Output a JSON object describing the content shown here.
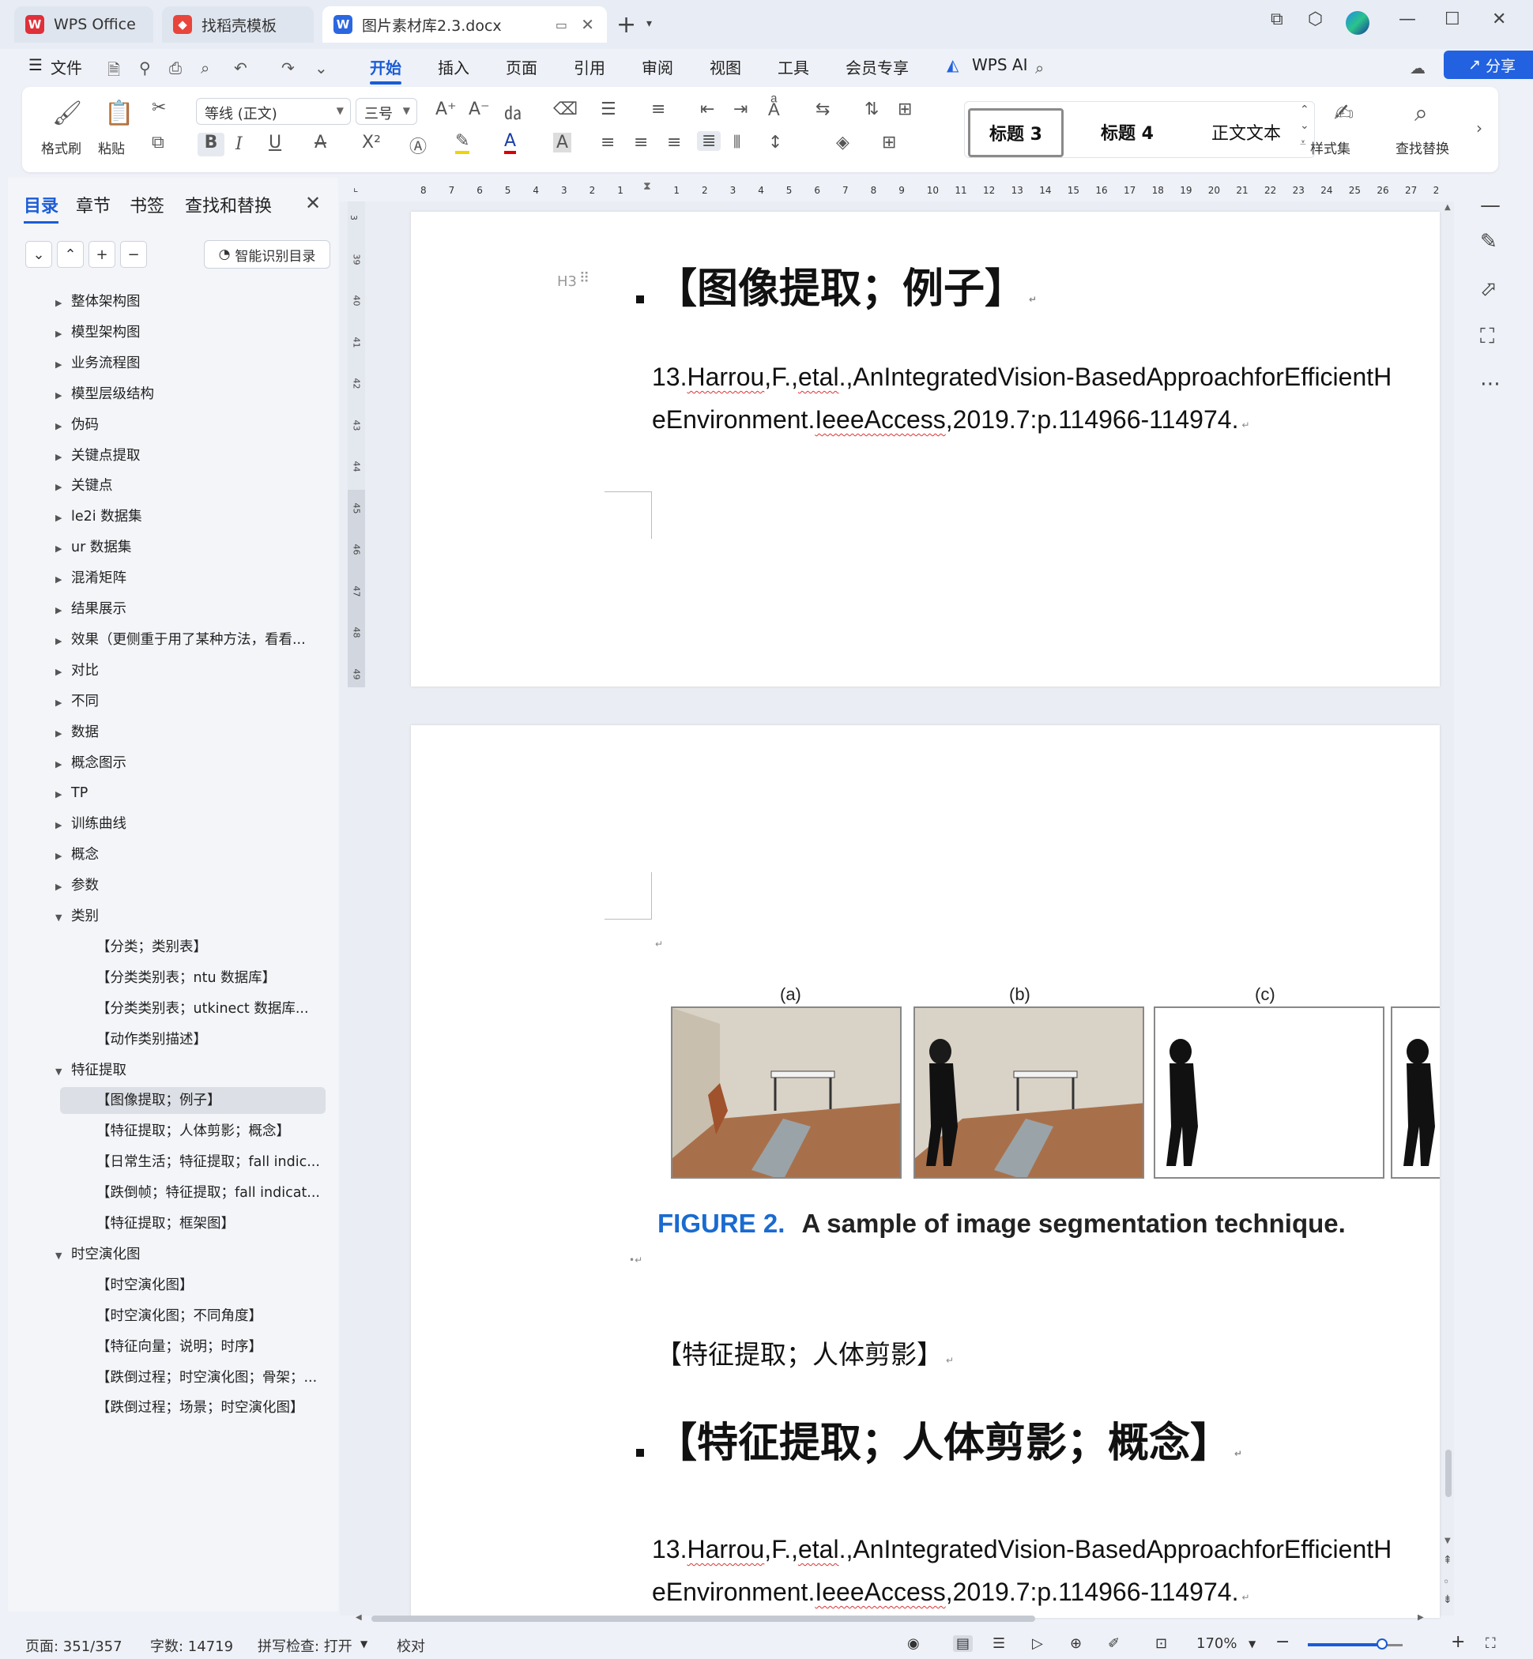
{
  "tabs": {
    "wps": "WPS Office",
    "template": "找稻壳模板",
    "doc": "图片素材库2.3.docx"
  },
  "menu": {
    "file": "文件",
    "items": [
      "开始",
      "插入",
      "页面",
      "引用",
      "审阅",
      "视图",
      "工具",
      "会员专享"
    ],
    "wps_ai": "WPS AI",
    "share": "分享"
  },
  "ribbon": {
    "format_painter": "格式刷",
    "paste": "粘贴",
    "font_name": "等线 (正文)",
    "font_size": "三号",
    "styles": [
      "标题 3",
      "标题 4",
      "正文文本"
    ],
    "style_set": "样式集",
    "find_replace": "查找替换"
  },
  "sidebar": {
    "tabs": [
      "目录",
      "章节",
      "书签",
      "查找和替换"
    ],
    "smart_toc": "智能识别目录",
    "items": [
      {
        "label": "整体架构图",
        "level": 1,
        "state": "collapsed"
      },
      {
        "label": "模型架构图",
        "level": 1,
        "state": "collapsed"
      },
      {
        "label": "业务流程图",
        "level": 1,
        "state": "collapsed"
      },
      {
        "label": "模型层级结构",
        "level": 1,
        "state": "collapsed"
      },
      {
        "label": "伪码",
        "level": 1,
        "state": "collapsed"
      },
      {
        "label": "关键点提取",
        "level": 1,
        "state": "collapsed"
      },
      {
        "label": "关键点",
        "level": 1,
        "state": "collapsed"
      },
      {
        "label": "le2i 数据集",
        "level": 1,
        "state": "collapsed"
      },
      {
        "label": "ur 数据集",
        "level": 1,
        "state": "collapsed"
      },
      {
        "label": "混淆矩阵",
        "level": 1,
        "state": "collapsed"
      },
      {
        "label": "结果展示",
        "level": 1,
        "state": "collapsed"
      },
      {
        "label": "效果（更侧重于用了某种方法，看看...",
        "level": 1,
        "state": "collapsed"
      },
      {
        "label": "对比",
        "level": 1,
        "state": "collapsed"
      },
      {
        "label": "不同",
        "level": 1,
        "state": "collapsed"
      },
      {
        "label": "数据",
        "level": 1,
        "state": "collapsed"
      },
      {
        "label": "概念图示",
        "level": 1,
        "state": "collapsed"
      },
      {
        "label": "TP",
        "level": 1,
        "state": "collapsed"
      },
      {
        "label": "训练曲线",
        "level": 1,
        "state": "collapsed"
      },
      {
        "label": "概念",
        "level": 1,
        "state": "collapsed"
      },
      {
        "label": "参数",
        "level": 1,
        "state": "collapsed"
      },
      {
        "label": "类别",
        "level": 1,
        "state": "expanded"
      },
      {
        "label": "【分类；类别表】",
        "level": 2,
        "state": "leaf"
      },
      {
        "label": "【分类类别表；ntu 数据库】",
        "level": 2,
        "state": "leaf"
      },
      {
        "label": "【分类类别表；utkinect 数据库...",
        "level": 2,
        "state": "leaf"
      },
      {
        "label": "【动作类别描述】",
        "level": 2,
        "state": "leaf"
      },
      {
        "label": "特征提取",
        "level": 1,
        "state": "expanded"
      },
      {
        "label": "【图像提取；例子】",
        "level": 2,
        "state": "selected"
      },
      {
        "label": "【特征提取；人体剪影；概念】",
        "level": 2,
        "state": "leaf"
      },
      {
        "label": "【日常生活；特征提取；fall indic...",
        "level": 2,
        "state": "leaf"
      },
      {
        "label": "【跌倒帧；特征提取；fall indicat...",
        "level": 2,
        "state": "leaf"
      },
      {
        "label": "【特征提取；框架图】",
        "level": 2,
        "state": "leaf"
      },
      {
        "label": "时空演化图",
        "level": 1,
        "state": "expanded"
      },
      {
        "label": "【时空演化图】",
        "level": 2,
        "state": "leaf"
      },
      {
        "label": "【时空演化图；不同角度】",
        "level": 2,
        "state": "leaf"
      },
      {
        "label": "【特征向量；说明；时序】",
        "level": 2,
        "state": "leaf"
      },
      {
        "label": "【跌倒过程；时空演化图；骨架；...",
        "level": 2,
        "state": "leaf"
      },
      {
        "label": "【跌倒过程；场景；时空演化图】",
        "level": 2,
        "state": "leaf"
      }
    ]
  },
  "ruler": {
    "h_numbers": [
      "8",
      "7",
      "6",
      "5",
      "4",
      "3",
      "2",
      "1",
      "",
      "1",
      "2",
      "3",
      "4",
      "5",
      "6",
      "7",
      "8",
      "9",
      "10",
      "11",
      "12",
      "13",
      "14",
      "15",
      "16",
      "17",
      "18",
      "19",
      "20",
      "21",
      "22",
      "23",
      "24",
      "25",
      "26",
      "27",
      "2"
    ],
    "v_numbers": [
      "3",
      "39",
      "40",
      "41",
      "42",
      "43",
      "44",
      "45",
      "46",
      "47",
      "48",
      "49"
    ]
  },
  "document": {
    "heading1": "【图像提取；例子】",
    "heading_marker": "H3",
    "ref1_line1": "13.Harrou,F.,etal.,AnIntegratedVision-BasedApproachforEfficientH",
    "ref1_line2": "eEnvironment.IeeeAccess,2019.7:p.114966-114974.",
    "figure": {
      "labels": [
        "(a)",
        "(b)",
        "(c)"
      ],
      "caption_prefix": "FIGURE 2.",
      "caption_text": "A sample of image segmentation technique."
    },
    "paragraph": "【特征提取；人体剪影】",
    "heading2": "【特征提取；人体剪影；概念】",
    "ref2_line1": "13.Harrou,F.,etal.,AnIntegratedVision-BasedApproachforEfficientH",
    "ref2_line2": "eEnvironment.IeeeAccess,2019.7:p.114966-114974."
  },
  "status": {
    "page": "页面: 351/357",
    "words": "字数: 14719",
    "spell": "拼写检查: 打开",
    "proof": "校对",
    "zoom": "170%",
    "zoom_fraction": 0.78
  },
  "colors": {
    "accent": "#1a5cd6",
    "share": "#2262e0",
    "caption_blue": "#1a6bd0"
  }
}
